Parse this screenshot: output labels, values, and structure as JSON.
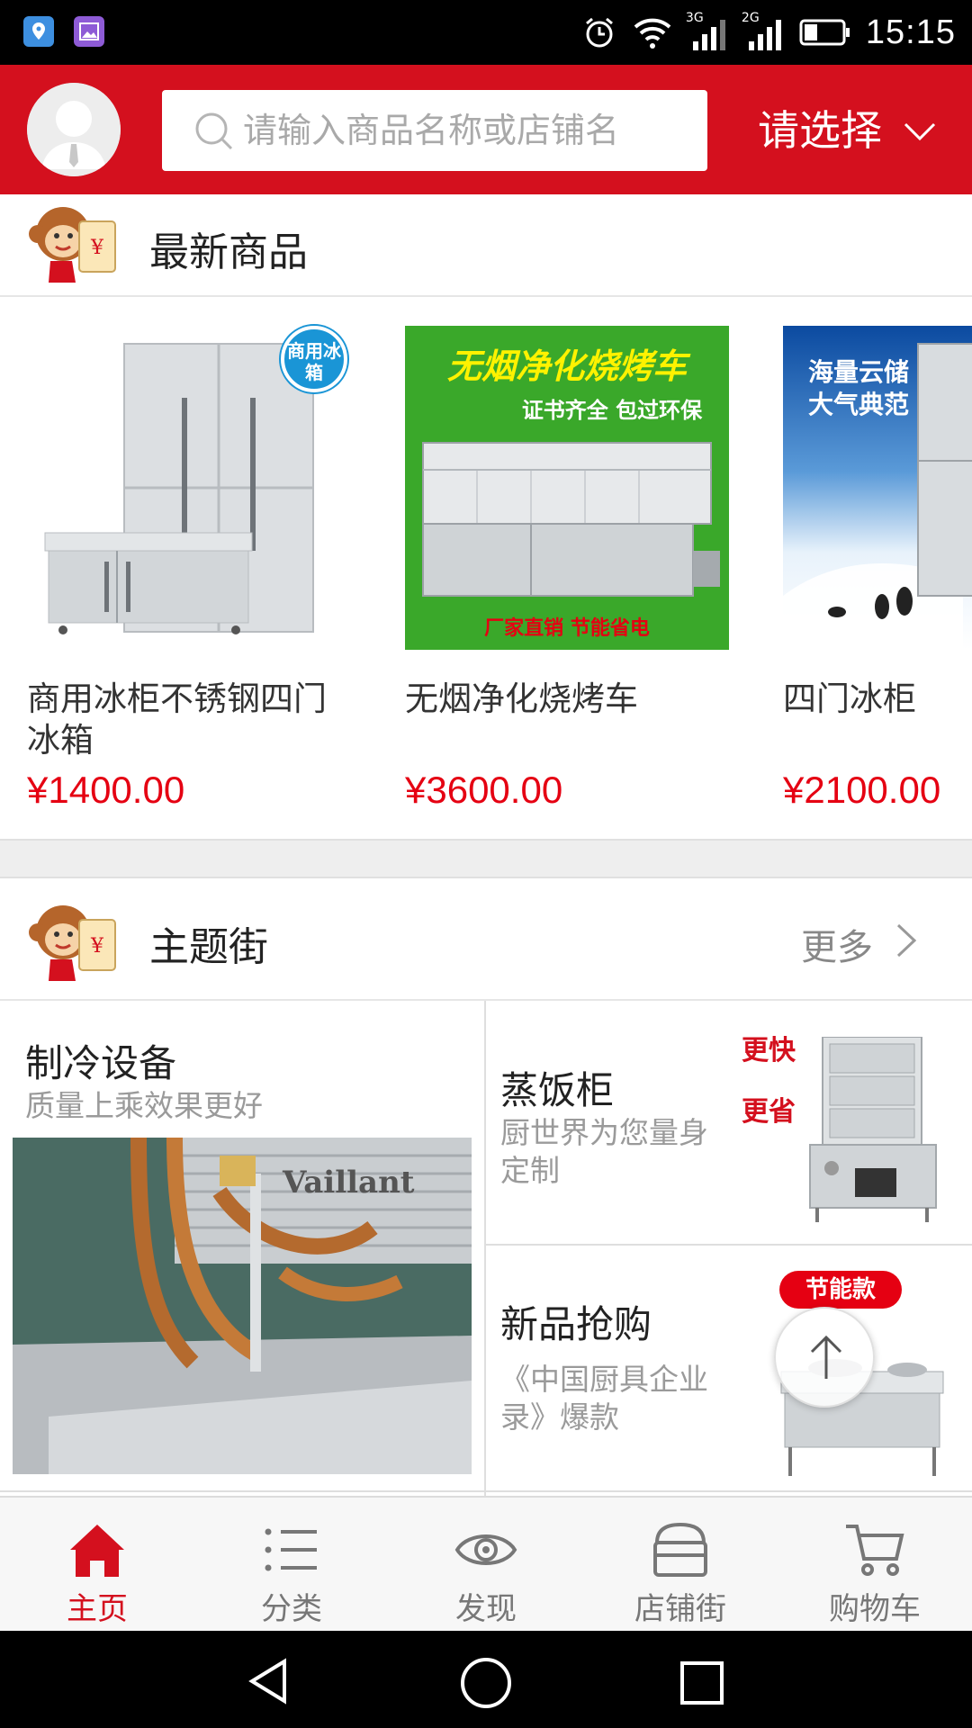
{
  "status_bar": {
    "time": "15:15",
    "network_1": "3G",
    "network_2": "2G",
    "icons": [
      "location-app-icon",
      "gallery-app-icon",
      "alarm-icon",
      "wifi-icon",
      "signal-icon",
      "battery-icon"
    ]
  },
  "header": {
    "search_placeholder": "请输入商品名称或店铺名",
    "select_label": "请选择",
    "brand_color": "#d4101e"
  },
  "latest": {
    "title": "最新商品",
    "products": [
      {
        "name": "商用冰柜不锈钢四门冰箱",
        "price": "¥1400.00",
        "badge": "商用冰箱"
      },
      {
        "name": "无烟净化烧烤车",
        "price": "¥3600.00",
        "banner": "无烟净化烧烤车",
        "tagline": "证书齐全 包过环保",
        "footer": "厂家直销 节能省电"
      },
      {
        "name": "四门冰柜",
        "price": "¥2100.00",
        "banner_1": "海量云储",
        "banner_2": "大气典范"
      }
    ]
  },
  "theme": {
    "title": "主题街",
    "more_label": "更多",
    "items": [
      {
        "title": "制冷设备",
        "subtitle": "质量上乘效果更好",
        "logo_text": "Vaillant"
      },
      {
        "title": "蒸饭柜",
        "subtitle": "厨世界为您量身定制",
        "tag_1": "更快",
        "tag_2": "更省"
      },
      {
        "title": "新品抢购",
        "subtitle": "《中国厨具企业录》爆款",
        "badge": "节能款"
      }
    ]
  },
  "bottom_nav": [
    {
      "label": "主页",
      "icon": "home-icon",
      "active": true
    },
    {
      "label": "分类",
      "icon": "list-icon",
      "active": false
    },
    {
      "label": "发现",
      "icon": "eye-icon",
      "active": false
    },
    {
      "label": "店铺街",
      "icon": "store-icon",
      "active": false
    },
    {
      "label": "购物车",
      "icon": "cart-icon",
      "active": false
    }
  ],
  "colors": {
    "accent": "#d4101e",
    "price": "#e50012"
  }
}
